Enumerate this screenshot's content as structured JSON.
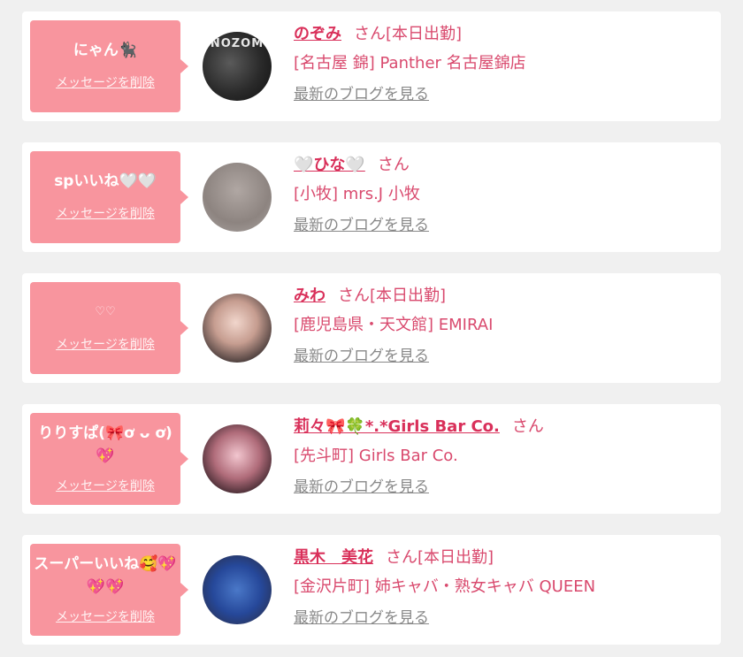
{
  "colors": {
    "accent_pink": "#f8959e",
    "name_red": "#d9305a",
    "text_pink": "#d94a6e",
    "link_gray": "#888888",
    "background": "#f0f0f0",
    "card": "#ffffff"
  },
  "items": [
    {
      "message": "にゃん🐈‍⬛",
      "delete_label": "メッセージを削除",
      "avatar_icon": "profile-photo",
      "avatar_tag": "NOZOM",
      "name": "のぞみ",
      "honorific": "さん",
      "status": "[本日出勤]",
      "shop": "[名古屋 錦] Panther 名古屋錦店",
      "blog_link": "最新のブログを見る"
    },
    {
      "message": "spいいね🤍🤍",
      "delete_label": "メッセージを削除",
      "avatar_icon": "profile-photo",
      "name": "🤍ひな🤍",
      "honorific": "さん",
      "status": "",
      "shop": "[小牧] mrs.J 小牧",
      "blog_link": "最新のブログを見る"
    },
    {
      "message": "♡♡",
      "delete_label": "メッセージを削除",
      "avatar_icon": "profile-photo",
      "name": "みわ",
      "honorific": "さん",
      "status": "[本日出勤]",
      "shop": "[鹿児島県・天文館] EMIRAI",
      "blog_link": "最新のブログを見る"
    },
    {
      "message": "りりすぱ(🎀ơ ᴗ ơ)💖",
      "delete_label": "メッセージを削除",
      "avatar_icon": "profile-photo",
      "name": "莉々🎀🍀*.*Girls Bar Co.",
      "honorific": "さん",
      "status": "",
      "shop": "[先斗町] Girls Bar Co.",
      "blog_link": "最新のブログを見る"
    },
    {
      "message": "スーパーいいね🥰💖💖💖",
      "delete_label": "メッセージを削除",
      "avatar_icon": "profile-photo",
      "name": "黒木　美花",
      "honorific": "さん",
      "status": "[本日出勤]",
      "shop": "[金沢片町] 姉キャバ・熟女キャバ QUEEN",
      "blog_link": "最新のブログを見る"
    }
  ]
}
